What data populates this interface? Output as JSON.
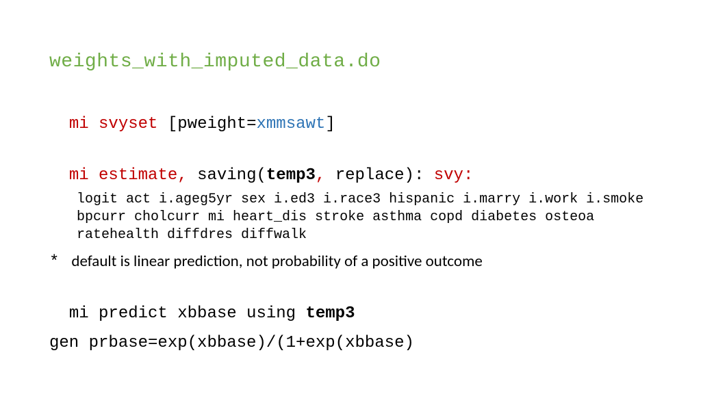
{
  "title": "weights_with_imputed_data.do",
  "line1": {
    "mi": "mi ",
    "cmd": "svyset",
    "open": " [pweight=",
    "var": "xmmsawt",
    "close": "]"
  },
  "line2": {
    "mi": "mi ",
    "cmd": "estimate",
    "comma": ", ",
    "saving_open": "saving(",
    "temp": "temp3",
    "comma2": ", ",
    "replace": "replace): ",
    "svy": "svy:"
  },
  "block": "logit act i.ageg5yr sex i.ed3 i.race3 hispanic i.marry i.work i.smoke bpcurr cholcurr mi heart_dis stroke asthma copd diabetes osteoa ratehealth diffdres diffwalk",
  "comment": {
    "star": "*",
    "text": "default is linear prediction, not probability of a positive outcome"
  },
  "line3": {
    "pre": "mi predict xbbase using ",
    "temp": "temp3"
  },
  "line4": "gen prbase=exp(xbbase)/(1+exp(xbbase)"
}
